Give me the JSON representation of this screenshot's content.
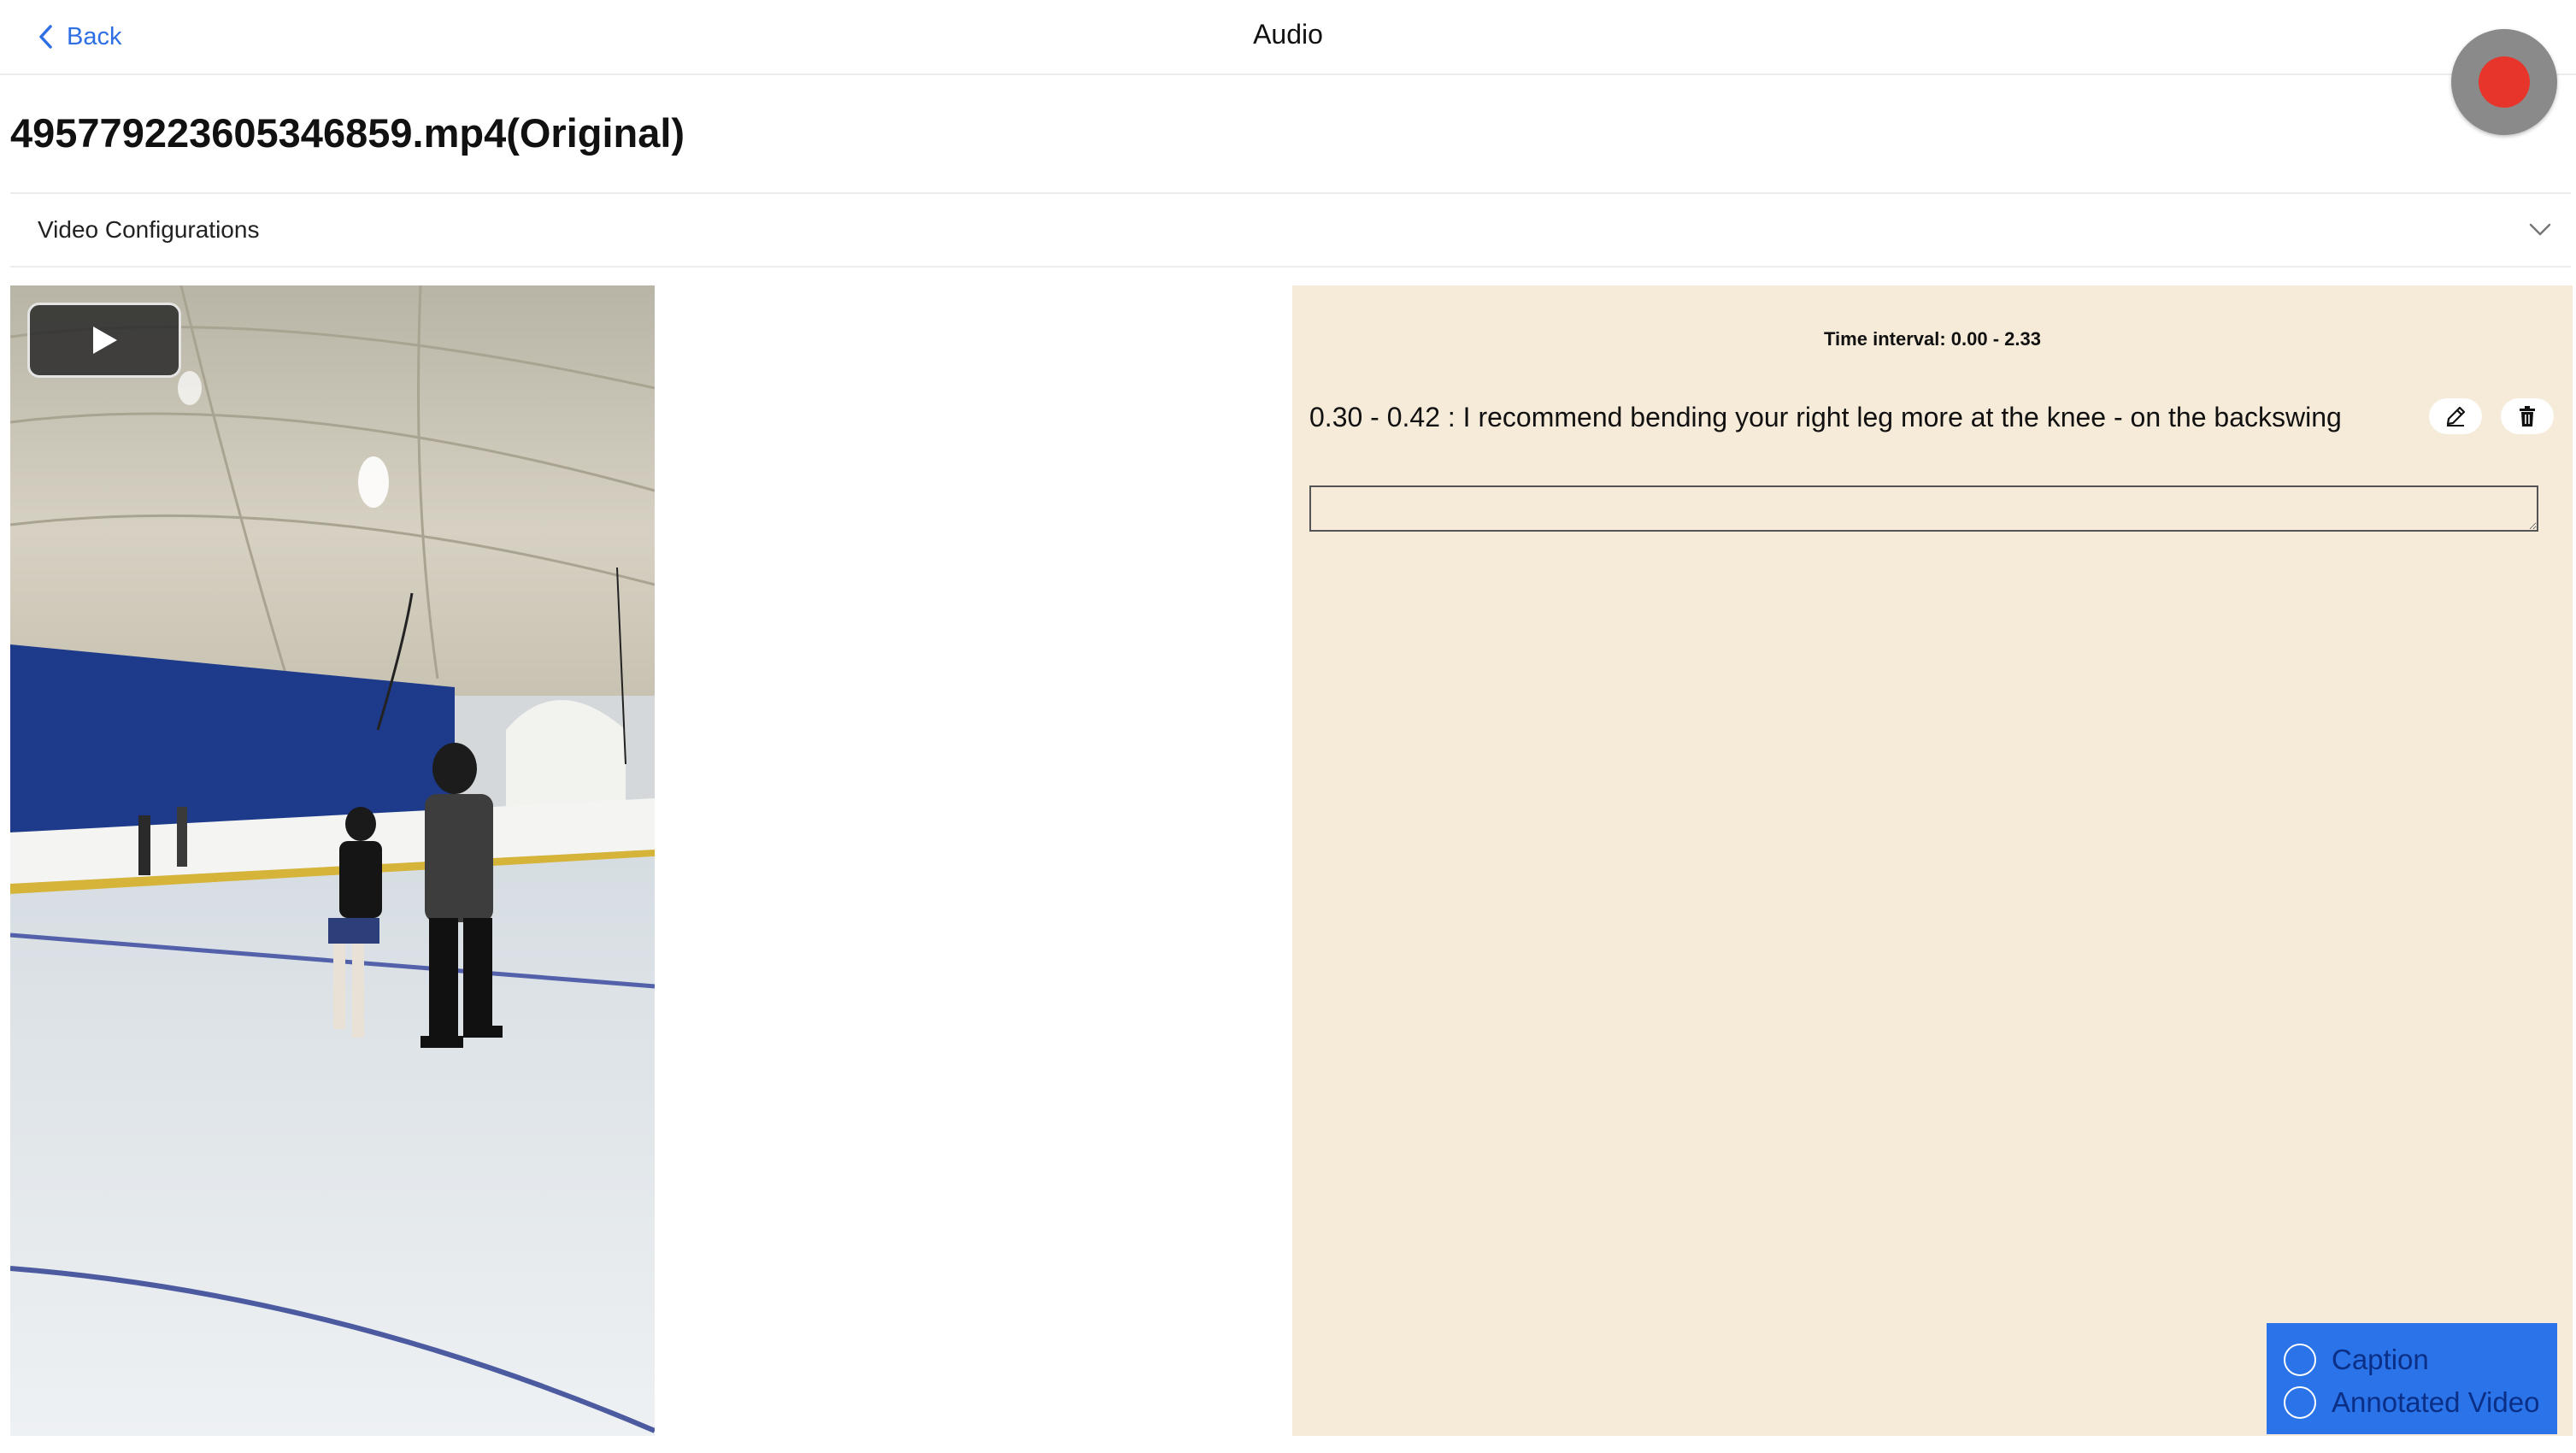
{
  "nav": {
    "back_label": "Back",
    "title": "Audio"
  },
  "file": {
    "title": "495779223605346859.mp4(Original)"
  },
  "config": {
    "label": "Video Configurations"
  },
  "panel": {
    "interval": "Time interval: 0.00 - 2.33",
    "comments": [
      {
        "text": "0.30 - 0.42 : I recommend bending your right leg more at the knee - on the backswing"
      }
    ],
    "input_value": ""
  },
  "options": [
    {
      "label": "Caption"
    },
    {
      "label": "Annotated Video"
    }
  ],
  "colors": {
    "accent": "#2f6fe4",
    "record": "#e8352b",
    "panel_bg": "#f6ead9",
    "option_bg": "#2a73e8"
  }
}
